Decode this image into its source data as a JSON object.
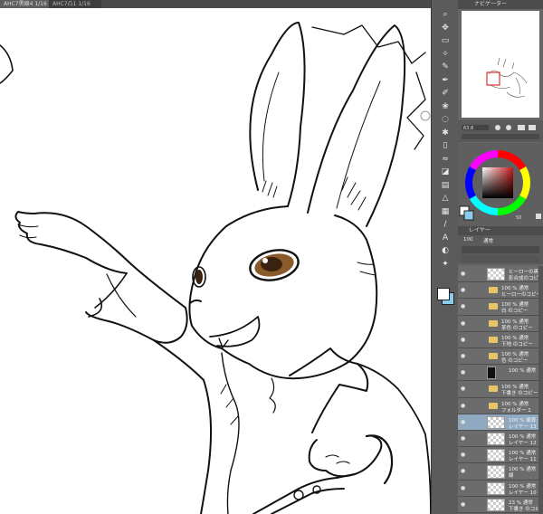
{
  "tabs": [
    {
      "label": "AHC7黒線4 1/16"
    },
    {
      "label": "AHC7凸1 1/16"
    }
  ],
  "canvas": {
    "subject": "white-rabbit-line-art"
  },
  "toolbar": {
    "tools": [
      "zoom-icon",
      "move-icon",
      "select-icon",
      "wand-icon",
      "eyedrop-icon",
      "pen-icon",
      "pencil-icon",
      "brush-icon",
      "airbrush-icon",
      "decorate-icon",
      "eraser-icon",
      "blend-icon",
      "fill-icon",
      "gradient-icon",
      "figure-icon",
      "frame-icon",
      "ruler-icon",
      "text-icon",
      "balloon-icon",
      "correct-icon"
    ]
  },
  "navigator": {
    "title": "ナビゲーター"
  },
  "color": {
    "main": "#ffffff",
    "sub": "#88ccee",
    "hue_accent": "#c81a1a",
    "value_label": "50"
  },
  "layers": {
    "title": "レイヤー",
    "mode_label": "通常",
    "opacity_label": "100",
    "items": [
      {
        "line1": "ヒーローの黒",
        "line2": "影合成のコピー",
        "kind": "layer"
      },
      {
        "line1": "100 % 通常",
        "line2": "ヒーローのコピー",
        "kind": "folder"
      },
      {
        "line1": "100 % 通常",
        "line2": "白 のコピー",
        "kind": "folder"
      },
      {
        "line1": "100 % 通常",
        "line2": "茶色 のコピー",
        "kind": "folder"
      },
      {
        "line1": "100 % 通常",
        "line2": "下地 のコピー",
        "kind": "folder"
      },
      {
        "line1": "100 % 通常",
        "line2": "色 のコピー",
        "kind": "folder"
      },
      {
        "line1": "100 % 通常",
        "line2": "",
        "kind": "mask"
      },
      {
        "line1": "100 % 通常",
        "line2": "下書き のコピー",
        "kind": "folder"
      },
      {
        "line1": "100 % 通常",
        "line2": "フォルダー 1",
        "kind": "folder"
      },
      {
        "line1": "100 % 乗算",
        "line2": "レイヤー 13",
        "kind": "layer",
        "selected": true
      },
      {
        "line1": "100 % 通常",
        "line2": "レイヤー 12",
        "kind": "layer"
      },
      {
        "line1": "100 % 通常",
        "line2": "レイヤー 11",
        "kind": "layer"
      },
      {
        "line1": "100 % 通常",
        "line2": "線",
        "kind": "layer"
      },
      {
        "line1": "100 % 通常",
        "line2": "レイヤー 10",
        "kind": "layer"
      },
      {
        "line1": "23 % 通常",
        "line2": "下書き のコピー",
        "kind": "layer"
      }
    ]
  }
}
